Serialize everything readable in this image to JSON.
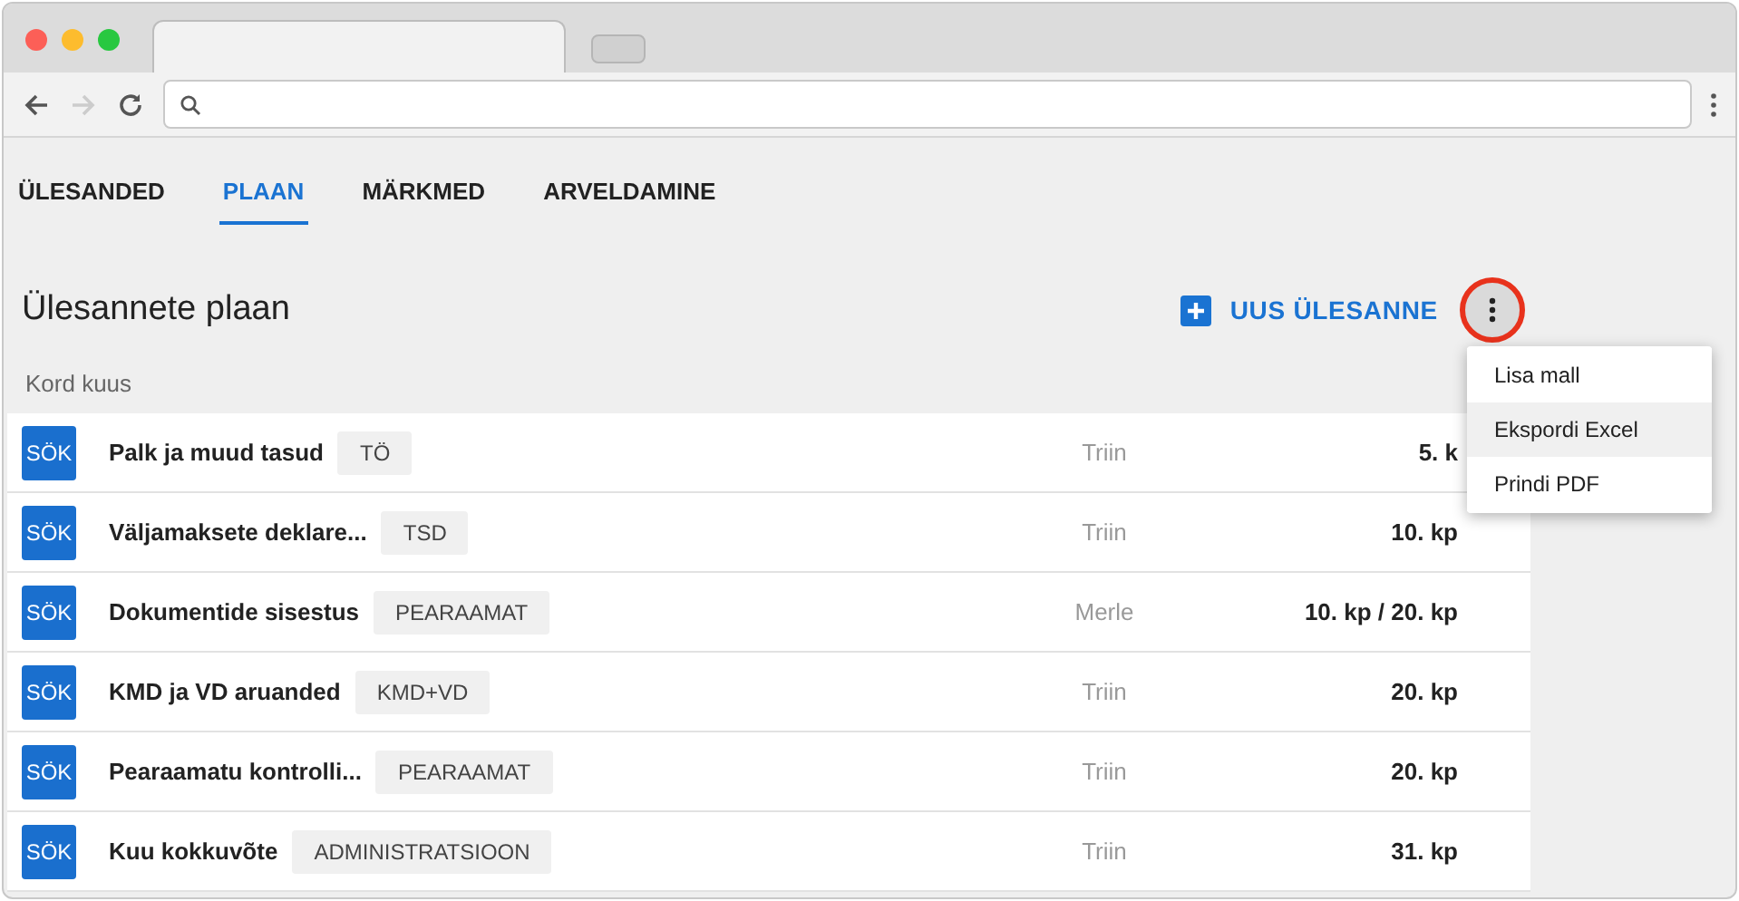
{
  "nav_tabs": [
    {
      "label": "ÜLESANDED",
      "selected": false
    },
    {
      "label": "PLAAN",
      "selected": true
    },
    {
      "label": "MÄRKMED",
      "selected": false
    },
    {
      "label": "ARVELDAMINE",
      "selected": false
    }
  ],
  "page_title": "Ülesannete plaan",
  "new_task_button": "UUS ÜLESANNE",
  "menu": [
    {
      "label": "Lisa mall",
      "selected": false
    },
    {
      "label": "Ekspordi Excel",
      "selected": true
    },
    {
      "label": "Prindi PDF",
      "selected": false
    }
  ],
  "group_label": "Kord kuus",
  "tasks": [
    {
      "badge": "SÖK",
      "name": "Palk ja muud tasud",
      "tag": "TÖ",
      "person": "Triin",
      "due": "5. k"
    },
    {
      "badge": "SÖK",
      "name": "Väljamaksete deklare...",
      "tag": "TSD",
      "person": "Triin",
      "due": "10. kp"
    },
    {
      "badge": "SÖK",
      "name": "Dokumentide sisestus",
      "tag": "PEARAAMAT",
      "person": "Merle",
      "due": "10. kp / 20. kp"
    },
    {
      "badge": "SÖK",
      "name": "KMD ja VD aruanded",
      "tag": "KMD+VD",
      "person": "Triin",
      "due": "20. kp"
    },
    {
      "badge": "SÖK",
      "name": "Pearaamatu kontrolli...",
      "tag": "PEARAAMAT",
      "person": "Triin",
      "due": "20. kp"
    },
    {
      "badge": "SÖK",
      "name": "Kuu kokkuvõte",
      "tag": "ADMINISTRATSIOON",
      "person": "Triin",
      "due": "31. kp"
    }
  ]
}
